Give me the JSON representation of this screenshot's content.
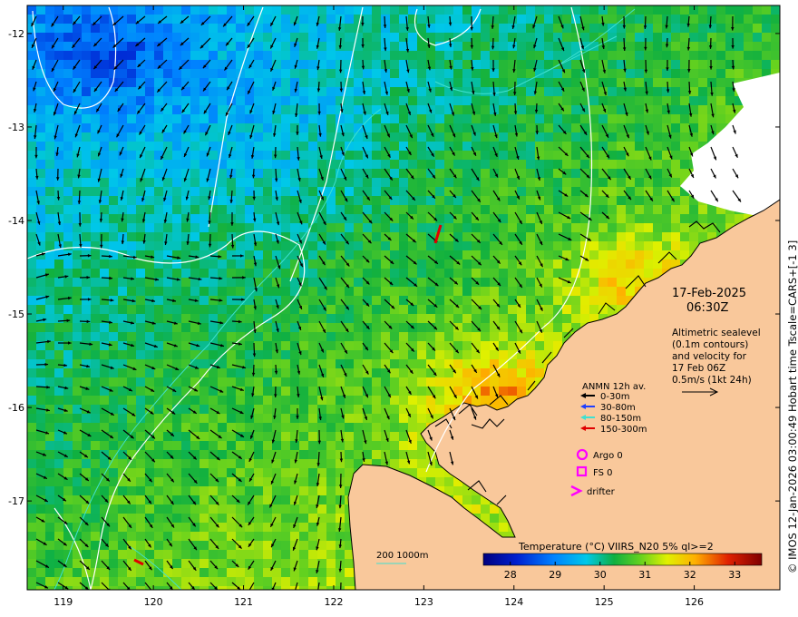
{
  "credit": "© IMOS 12-Jan-2026 03:00:49 Hobart time Tscale=CARS+[-1 3]",
  "date": "17-Feb-2025",
  "time": "06:30Z",
  "description_lines": [
    "Altimetric sealevel",
    "(0.1m contours)",
    "and velocity for",
    "17 Feb 06Z",
    "0.5m/s (1kt 24h)"
  ],
  "legend": {
    "title": "ANMN 12h av.",
    "items": [
      {
        "label": "0-30m",
        "color": "#000000"
      },
      {
        "label": "30-80m",
        "color": "#1f3fff"
      },
      {
        "label": "80-150m",
        "color": "#40e0d0"
      },
      {
        "label": "150-300m",
        "color": "#e00000"
      }
    ],
    "markers": [
      {
        "label": "Argo 0",
        "shape": "circle",
        "color": "#ff00ff"
      },
      {
        "label": "FS 0",
        "shape": "square",
        "color": "#ff00ff"
      },
      {
        "label": "drifter",
        "shape": "chevron",
        "color": "#ff00ff"
      }
    ]
  },
  "isobath_label": "200  1000m",
  "colorbar": {
    "title": "Temperature (°C) VIIRS_N20 5% ql>=2",
    "min": 27.4,
    "max": 33.6,
    "ticks": [
      28,
      29,
      30,
      31,
      32,
      33
    ]
  },
  "map_axes": {
    "lon_ticks": [
      119,
      120,
      121,
      122,
      123,
      124,
      125,
      126
    ],
    "lat_ticks": [
      -12,
      -13,
      -14,
      -15,
      -16,
      -17
    ],
    "lon_range": [
      118.6,
      126.95
    ],
    "lat_range": [
      -11.7,
      -17.95
    ]
  },
  "colors": {
    "land": "#f9c89b",
    "coast": "#000000",
    "arrow": "#000000",
    "contour": "#ffffff",
    "isobath": "#40e0d0",
    "cloud": "#ffffff"
  }
}
